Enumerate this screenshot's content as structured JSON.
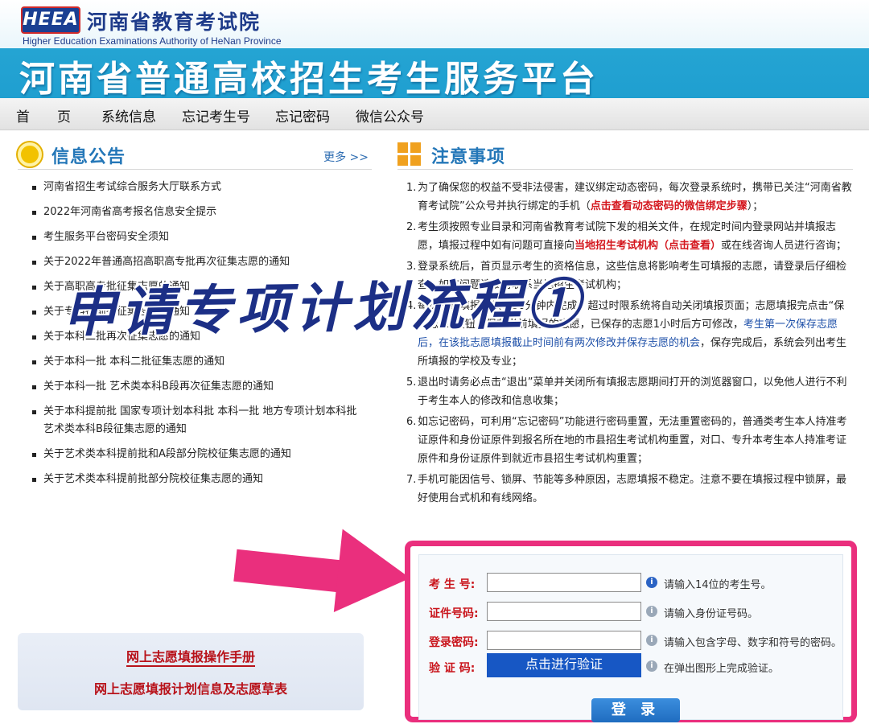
{
  "header": {
    "logo_text": "HEEA",
    "org_name": "河南省教育考试院",
    "org_name_en": "Higher Education Examinations Authority of HeNan Province",
    "platform_title": "河南省普通高校招生考生服务平台"
  },
  "nav": {
    "items": [
      "首　　页",
      "系统信息",
      "忘记考生号",
      "忘记密码",
      "微信公众号"
    ]
  },
  "notices": {
    "title": "信息公告",
    "more": "更多 >>",
    "items": [
      "河南省招生考试综合服务大厅联系方式",
      "2022年河南省高考报名信息安全提示",
      "考生服务平台密码安全须知",
      "关于2022年普通高招高职高专批再次征集志愿的通知",
      "关于高职高专批征集志愿的通知",
      "关于专科提前批征集志愿的通知",
      "关于本科二批再次征集志愿的通知",
      "关于本科一批 本科二批征集志愿的通知",
      "关于本科一批 艺术类本科B段再次征集志愿的通知",
      "关于本科提前批 国家专项计划本科批 本科一批 地方专项计划本科批 艺术类本科B段征集志愿的通知",
      "关于艺术类本科提前批和A段部分院校征集志愿的通知",
      "关于艺术类本科提前批部分院校征集志愿的通知"
    ]
  },
  "notes": {
    "title": "注意事项",
    "n1": {
      "num": "1.",
      "a": "为了确保您的权益不受非法侵害，建议绑定动态密码，每次登录系统时，携带已关注“河南省教育考试院”公众号并执行绑定的手机（",
      "link": "点击查看动态密码的微信绑定步骤",
      "b": "）；"
    },
    "n2": {
      "num": "2.",
      "a": "考生须按照专业目录和河南省教育考试院下发的相关文件，在规定时间内登录网站并填报志愿，填报过程中如有问题可直接向",
      "link": "当地招生考试机构（点击查看）",
      "b": "或在线咨询人员进行咨询；"
    },
    "n3": {
      "num": "3.",
      "a": "登录系统后，首页显示考生的资格信息，这些信息将影响考生可填报的志愿，请登录后仔细检查，如有问题请及时联系当地招生考试机构；"
    },
    "n4": {
      "num": "4.",
      "a": "每次志愿填报必须在30分钟内完成，超过时限系统将自动关闭填报页面；志愿填报完点击“保存志愿”按钮，保存当前填报的志愿，已保存的志愿1小时后方可修改，",
      "b": "考生第一次保存志愿后，在该批志愿填报截止时间前有两次修改并保存志愿的机会",
      "c": "，保存完成后，系统会列出考生所填报的学校及专业；"
    },
    "n5": {
      "num": "5.",
      "a": "退出时请务必点击“退出”菜单并关闭所有填报志愿期间打开的浏览器窗口，以免他人进行不利于考生本人的修改和信息收集；"
    },
    "n6": {
      "num": "6.",
      "a": "如忘记密码，可利用“忘记密码”功能进行密码重置，无法重置密码的，普通类考生本人持准考证原件和身份证原件到报名所在地的市县招生考试机构重置，对口、专升本考生本人持准考证原件和身份证原件到就近市县招生考试机构重置；"
    },
    "n7": {
      "num": "7.",
      "a": "手机可能因信号、锁屏、节能等多种原因，志愿填报不稳定。注意不要在填报过程中锁屏，最好使用台式机和有线网络。"
    }
  },
  "overlay": {
    "text": "申请专项计划流程①"
  },
  "login": {
    "exam_label": "考 生 号:",
    "exam_hint": "请输入14位的考生号。",
    "id_label": "证件号码:",
    "id_hint": "请输入身份证号码。",
    "pwd_label": "登录密码:",
    "pwd_hint": "请输入包含字母、数字和符号的密码。",
    "captcha_label": "验 证 码:",
    "verify_button": "点击进行验证",
    "captcha_hint": "在弹出图形上完成验证。",
    "login_button": "登 录"
  },
  "manual": {
    "link1": "网上志愿填报操作手册",
    "link2": "网上志愿填报计划信息及志愿草表"
  },
  "colors": {
    "header_blue": "#1f9fd0",
    "highlight_pink": "#ea2f7d",
    "alert_red": "#d4161d",
    "link_blue": "#1d4fa8"
  }
}
